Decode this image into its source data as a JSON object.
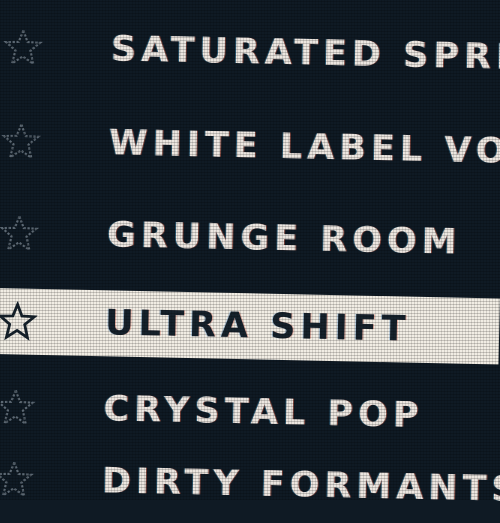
{
  "presets": [
    {
      "name": "SATURATED SPRE",
      "favorite_icon": "star-outline-icon",
      "selected": false
    },
    {
      "name": "WHITE LABEL VOX",
      "favorite_icon": "star-outline-icon",
      "selected": false
    },
    {
      "name": "GRUNGE ROOM",
      "favorite_icon": "star-outline-icon",
      "selected": false
    },
    {
      "name": "ULTRA SHIFT",
      "favorite_icon": "star-outline-icon",
      "selected": true
    },
    {
      "name": "CRYSTAL POP",
      "favorite_icon": "star-outline-icon",
      "selected": false
    },
    {
      "name": "DIRTY FORMANTS",
      "favorite_icon": "star-outline-icon",
      "selected": false
    }
  ],
  "colors": {
    "background": "#0f1a24",
    "text": "#ece6e0",
    "selected_background": "#f1ede4",
    "selected_text": "#16222c",
    "star_outline": "#5c6873"
  }
}
